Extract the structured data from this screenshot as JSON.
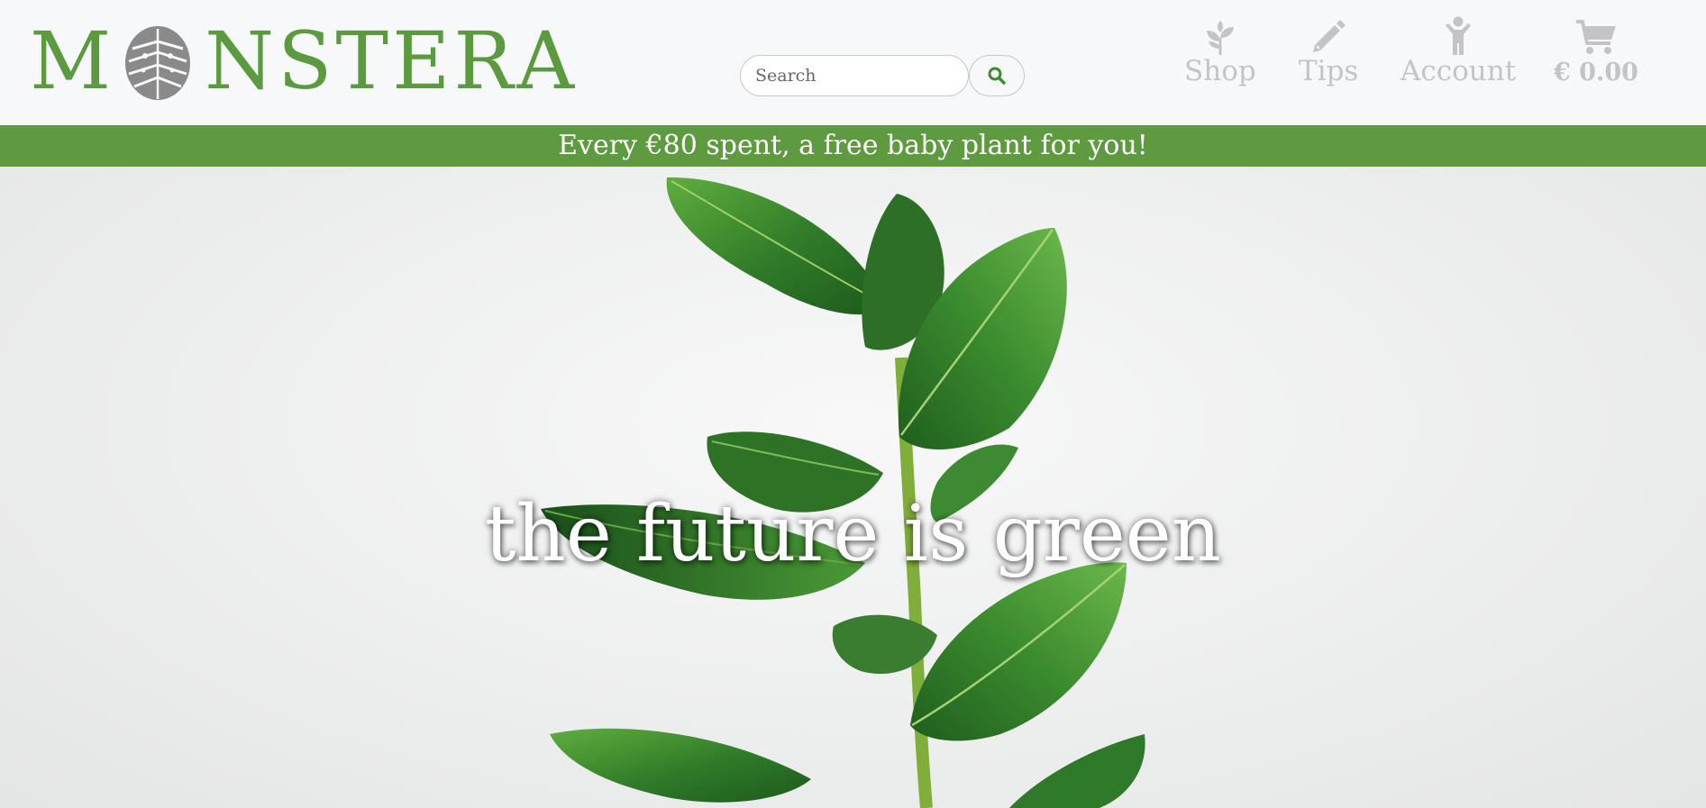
{
  "brand": {
    "logo_text_before": "M",
    "logo_text_after": "NSTERA",
    "logo_icon": "monstera-leaf-icon",
    "brand_color": "#5b9a3f"
  },
  "search": {
    "placeholder": "Search",
    "value": "",
    "button_icon": "search-icon"
  },
  "nav": {
    "items": [
      {
        "label": "Shop",
        "icon": "sprout-icon"
      },
      {
        "label": "Tips",
        "icon": "pencil-icon"
      },
      {
        "label": "Account",
        "icon": "person-icon"
      },
      {
        "label": "€ 0.00",
        "icon": "cart-icon"
      }
    ],
    "color": "#c4c4c8"
  },
  "promo": {
    "text": "Every €80 spent, a free baby plant for you!",
    "background": "#5e9a40"
  },
  "hero": {
    "title": "the future is green",
    "image": "rubber-plant-image"
  }
}
